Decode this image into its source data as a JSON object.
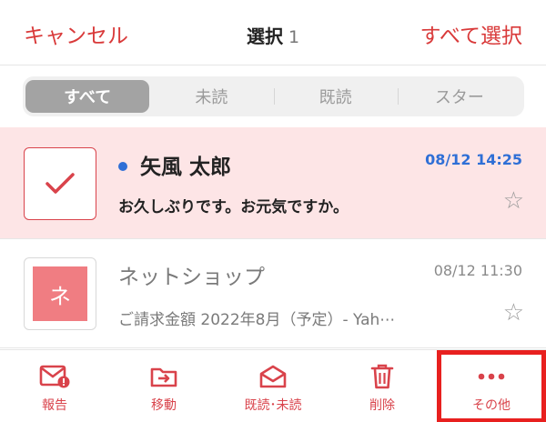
{
  "header": {
    "cancel_label": "キャンセル",
    "title": "選択",
    "selected_count": "1",
    "select_all_label": "すべて選択"
  },
  "filter": {
    "tabs": [
      "すべて",
      "未読",
      "既読",
      "スター"
    ],
    "active": "すべて"
  },
  "mails": [
    {
      "sender": "矢風 太郎",
      "date": "08/12 14:25",
      "subject": "お久しぶりです。お元気ですか。",
      "unread": true,
      "selected": true
    },
    {
      "sender": "ネットショップ",
      "avatar_letter": "ネ",
      "date": "08/12 11:30",
      "subject": "ご請求金額 2022年8月（予定）- Yah⋯",
      "unread": false,
      "selected": false
    }
  ],
  "toolbar": {
    "report_label": "報告",
    "move_label": "移動",
    "read_unread_label": "既読･未読",
    "delete_label": "削除",
    "more_label": "その他"
  },
  "colors": {
    "accent": "#d9434b",
    "unread_blue": "#2f6fd6",
    "selected_row_bg": "#fde5e6",
    "highlight_box": "#e8201f"
  },
  "icons": {
    "report": "mail-alert-icon",
    "move": "folder-move-icon",
    "read_unread": "envelope-open-icon",
    "delete": "trash-icon",
    "more": "more-dots-icon",
    "star": "star-outline-icon",
    "check": "checkmark-icon"
  }
}
